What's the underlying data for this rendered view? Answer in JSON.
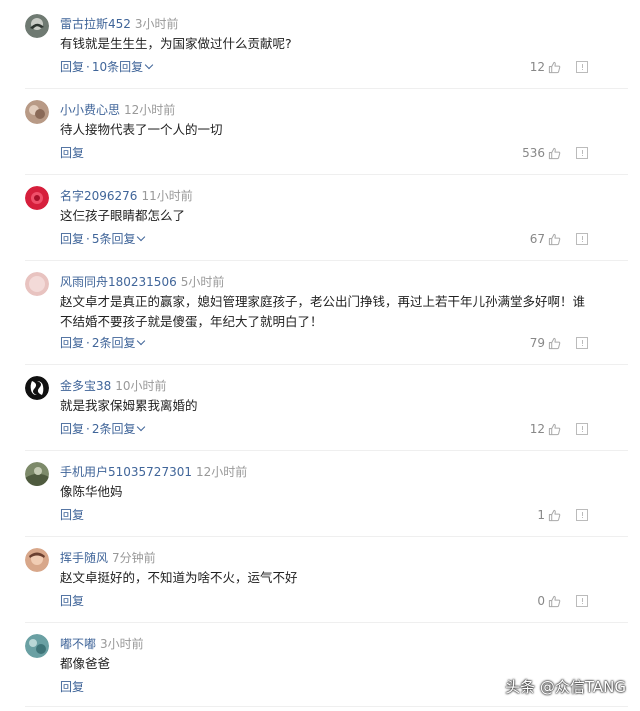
{
  "comments": [
    {
      "username": "雷古拉斯452",
      "time": "3小时前",
      "content": "有钱就是生生生，为国家做过什么贡献呢?",
      "reply_label": "回复",
      "replies_label": "10条回复",
      "likes": "12"
    },
    {
      "username": "小小费心思",
      "time": "12小时前",
      "content": "待人接物代表了一个人的一切",
      "reply_label": "回复",
      "replies_label": "",
      "likes": "536"
    },
    {
      "username": "名字2096276",
      "time": "11小时前",
      "content": "这仨孩子眼睛都怎么了",
      "reply_label": "回复",
      "replies_label": "5条回复",
      "likes": "67"
    },
    {
      "username": "风雨同舟180231506",
      "time": "5小时前",
      "content": "赵文卓才是真正的赢家，媳妇管理家庭孩子，老公出门挣钱，再过上若干年儿孙满堂多好啊！谁不结婚不要孩子就是傻蛋，年纪大了就明白了！",
      "reply_label": "回复",
      "replies_label": "2条回复",
      "likes": "79"
    },
    {
      "username": "金多宝38",
      "time": "10小时前",
      "content": "就是我家保姆累我离婚的",
      "reply_label": "回复",
      "replies_label": "2条回复",
      "likes": "12"
    },
    {
      "username": "手机用户51035727301",
      "time": "12小时前",
      "content": "像陈华他妈",
      "reply_label": "回复",
      "replies_label": "",
      "likes": "1"
    },
    {
      "username": "挥手随风",
      "time": "7分钟前",
      "content": "赵文卓挺好的，不知道为啥不火，运气不好",
      "reply_label": "回复",
      "replies_label": "",
      "likes": "0"
    },
    {
      "username": "嘟不嘟",
      "time": "3小时前",
      "content": "都像爸爸",
      "reply_label": "回复",
      "replies_label": "",
      "likes": ""
    }
  ],
  "watermark": "头条 @众信TANG",
  "colors": {
    "username": "#406599",
    "time": "#999999",
    "action_link": "#406599",
    "divider": "#efefef"
  },
  "icons": {
    "like": "thumbs-up-icon",
    "report": "report-icon",
    "expand": "chevron-down-icon"
  }
}
